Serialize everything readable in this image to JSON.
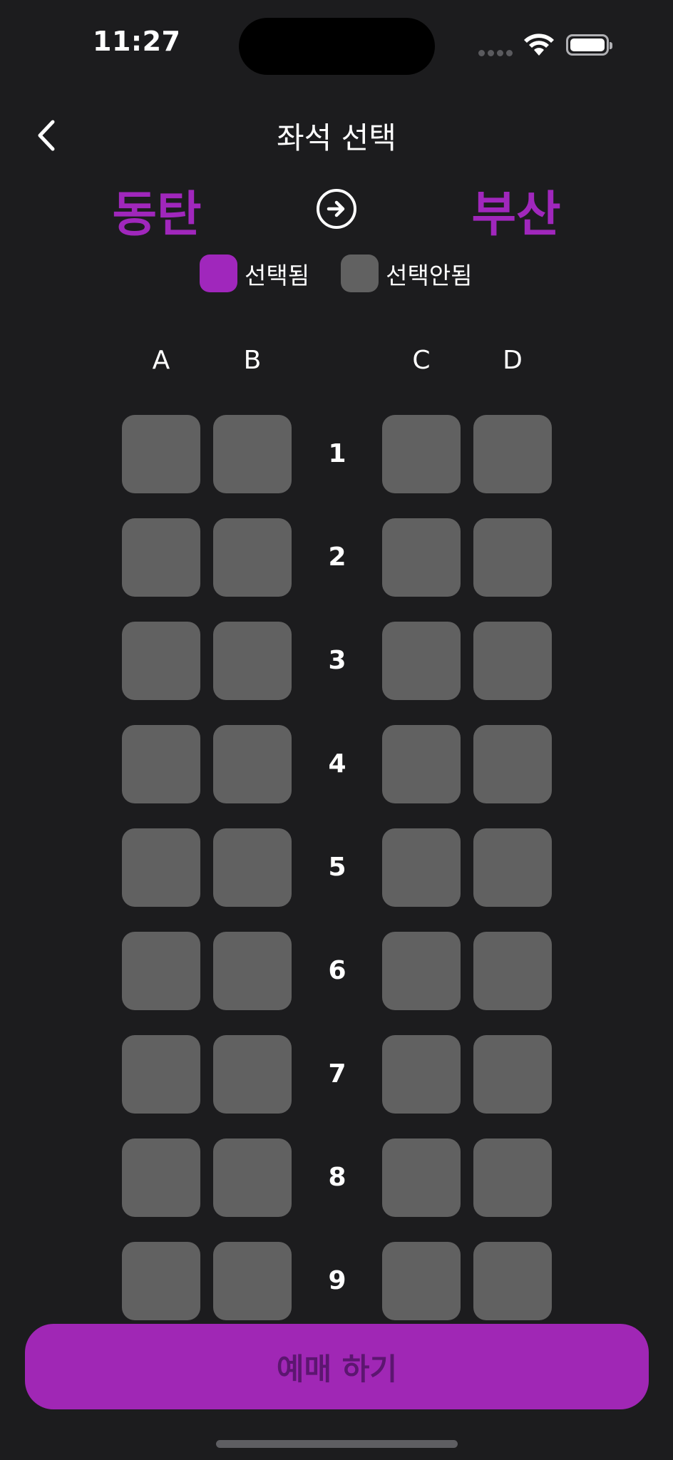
{
  "status_bar": {
    "time": "11:27"
  },
  "nav": {
    "title": "좌석 선택",
    "back_icon": "chevron-left-icon"
  },
  "route": {
    "from": "동탄",
    "to": "부산",
    "arrow_icon": "arrow-right-circle-icon"
  },
  "legend": {
    "selected_label": "선택됨",
    "unselected_label": "선택안됨",
    "selected_color": "#a027bc",
    "unselected_color": "#616161"
  },
  "columns": [
    "A",
    "B",
    "C",
    "D"
  ],
  "rows": [
    "1",
    "2",
    "3",
    "4",
    "5",
    "6",
    "7",
    "8",
    "9"
  ],
  "book_button": {
    "label": "예매 하기",
    "color": "#a027b5"
  }
}
